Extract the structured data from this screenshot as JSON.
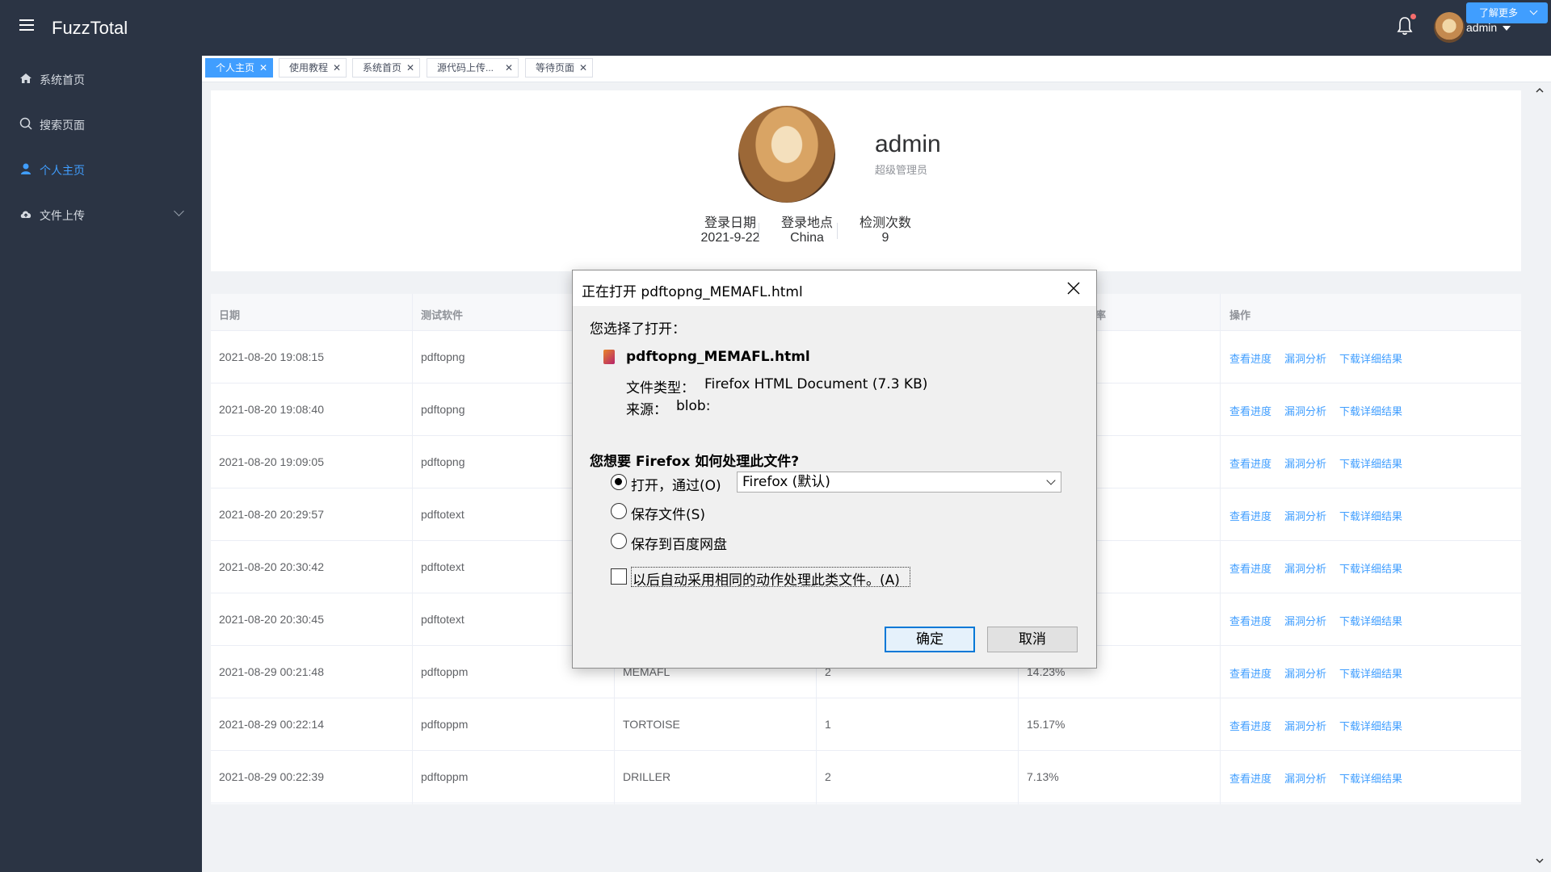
{
  "app": {
    "title": "FuzzTotal",
    "user": "admin"
  },
  "sidebar": {
    "items": [
      {
        "label": "系统首页",
        "icon": "home-icon"
      },
      {
        "label": "搜索页面",
        "icon": "search-icon"
      },
      {
        "label": "个人主页",
        "icon": "user-icon"
      },
      {
        "label": "文件上传",
        "icon": "cloud-upload-icon"
      }
    ]
  },
  "tabs": [
    {
      "label": "个人主页"
    },
    {
      "label": "使用教程"
    },
    {
      "label": "系统首页"
    },
    {
      "label": "源代码上传..."
    },
    {
      "label": "等待页面"
    }
  ],
  "more_button": "了解更多",
  "profile": {
    "name": "admin",
    "role": "超级管理员",
    "stats": [
      {
        "label": "登录日期",
        "value": "2021-9-22"
      },
      {
        "label": "登录地点",
        "value": "China"
      },
      {
        "label": "检测次数",
        "value": "9"
      }
    ]
  },
  "table": {
    "headers": [
      "日期",
      "测试软件",
      "",
      "",
      "率",
      "操作"
    ],
    "rows": [
      {
        "date": "2021-08-20 19:08:15",
        "software": "pdftopng",
        "tool": "",
        "count": "",
        "rate": ""
      },
      {
        "date": "2021-08-20 19:08:40",
        "software": "pdftopng",
        "tool": "",
        "count": "",
        "rate": ""
      },
      {
        "date": "2021-08-20 19:09:05",
        "software": "pdftopng",
        "tool": "",
        "count": "",
        "rate": ""
      },
      {
        "date": "2021-08-20 20:29:57",
        "software": "pdftotext",
        "tool": "",
        "count": "",
        "rate": ""
      },
      {
        "date": "2021-08-20 20:30:42",
        "software": "pdftotext",
        "tool": "",
        "count": "",
        "rate": ""
      },
      {
        "date": "2021-08-20 20:30:45",
        "software": "pdftotext",
        "tool": "",
        "count": "",
        "rate": ""
      },
      {
        "date": "2021-08-29 00:21:48",
        "software": "pdftoppm",
        "tool": "MEMAFL",
        "count": "2",
        "rate": "14.23%"
      },
      {
        "date": "2021-08-29 00:22:14",
        "software": "pdftoppm",
        "tool": "TORTOISE",
        "count": "1",
        "rate": "15.17%"
      },
      {
        "date": "2021-08-29 00:22:39",
        "software": "pdftoppm",
        "tool": "DRILLER",
        "count": "2",
        "rate": "7.13%"
      }
    ],
    "actions": [
      "查看进度",
      "漏洞分析",
      "下载详细结果"
    ]
  },
  "dialog": {
    "title": "正在打开 pdftopng_MEMAFL.html",
    "chose_label": "您选择了打开：",
    "filename": "pdftopng_MEMAFL.html",
    "filetype_label": "文件类型：",
    "filetype_value": "Firefox HTML Document (7.3 KB)",
    "source_label": "来源：",
    "source_value": "blob:",
    "question": "您想要 Firefox 如何处理此文件?",
    "open_with_label": "打开，通过(O)",
    "open_with_value": "Firefox (默认)",
    "save_label": "保存文件(S)",
    "baidu_label": "保存到百度网盘",
    "auto_label": "以后自动采用相同的动作处理此类文件。(A)",
    "ok_label": "确定",
    "cancel_label": "取消"
  },
  "colors": {
    "accent": "#409eff",
    "header_bg": "#2b3444"
  }
}
